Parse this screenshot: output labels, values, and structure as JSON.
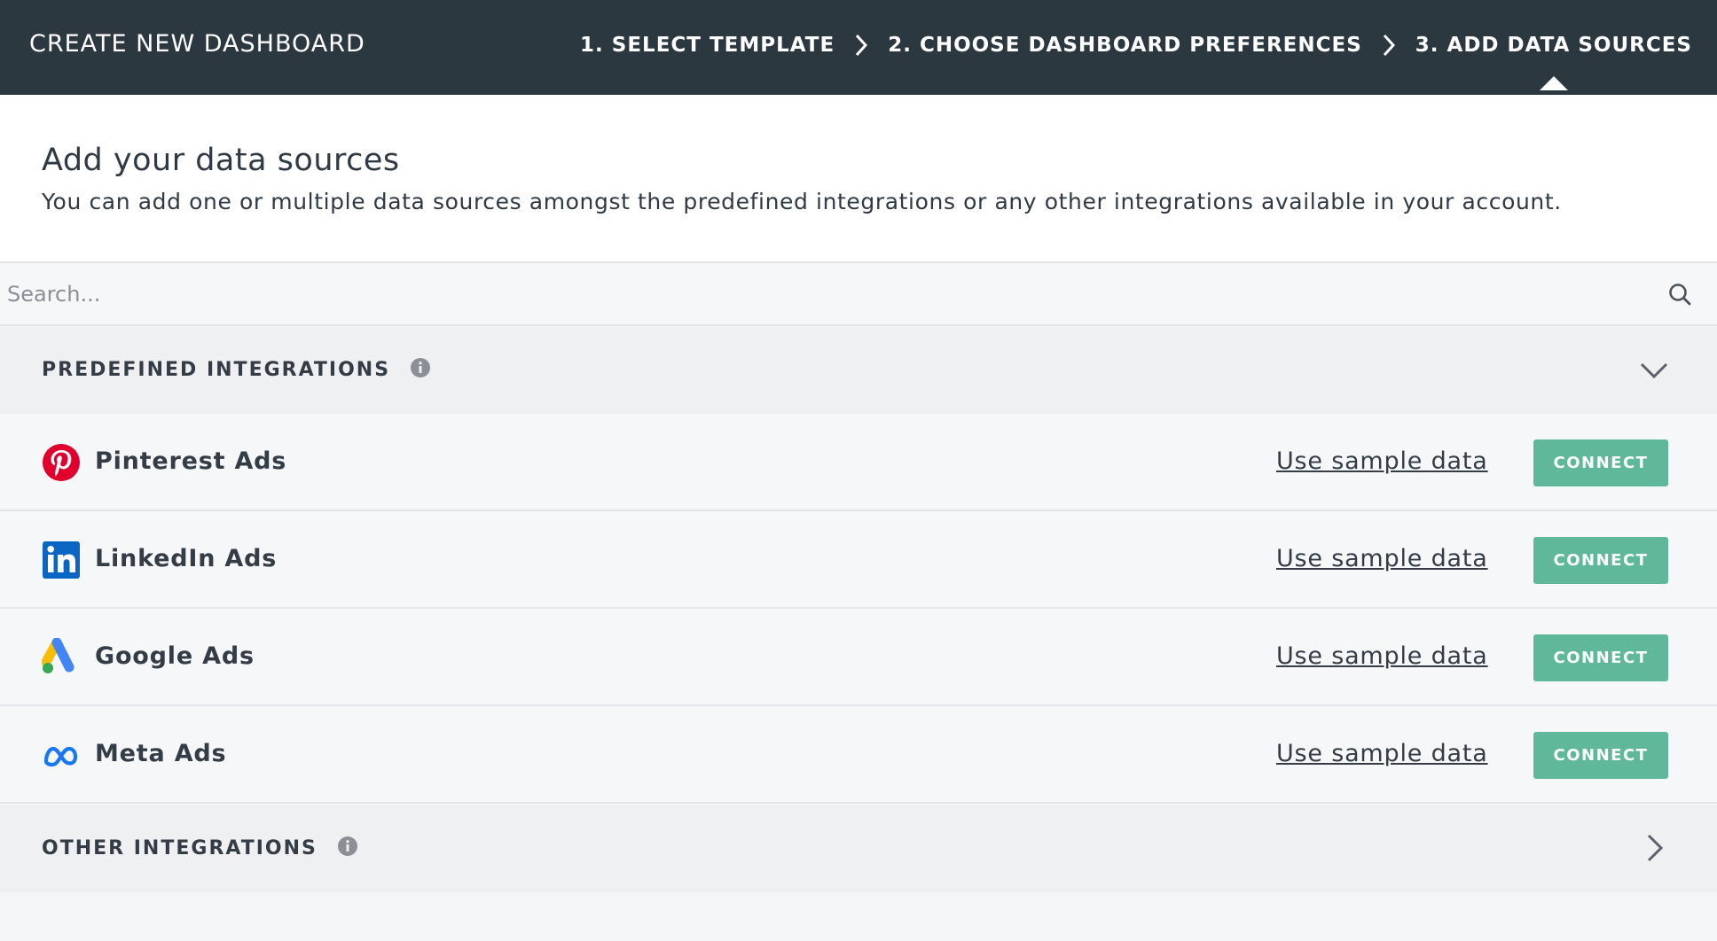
{
  "header": {
    "title": "CREATE NEW DASHBOARD",
    "steps": [
      {
        "label": "1. SELECT TEMPLATE"
      },
      {
        "label": "2. CHOOSE DASHBOARD PREFERENCES"
      },
      {
        "label": "3. ADD DATA SOURCES",
        "active": true
      }
    ]
  },
  "intro": {
    "heading": "Add your data sources",
    "description": "You can add one or multiple data sources amongst the predefined integrations or any other integrations available in your account."
  },
  "search": {
    "placeholder": "Search...",
    "value": "",
    "icon": "search-icon"
  },
  "predefined": {
    "label": "PREDEFINED INTEGRATIONS",
    "expanded": true,
    "items": [
      {
        "name": "Pinterest Ads",
        "icon": "pinterest-logo-icon",
        "sample_label": "Use sample data",
        "connect_label": "CONNECT"
      },
      {
        "name": "LinkedIn Ads",
        "icon": "linkedin-logo-icon",
        "sample_label": "Use sample data",
        "connect_label": "CONNECT"
      },
      {
        "name": "Google Ads",
        "icon": "google-ads-logo-icon",
        "sample_label": "Use sample data",
        "connect_label": "CONNECT"
      },
      {
        "name": "Meta Ads",
        "icon": "meta-logo-icon",
        "sample_label": "Use sample data",
        "connect_label": "CONNECT"
      }
    ]
  },
  "other": {
    "label": "OTHER INTEGRATIONS",
    "expanded": false
  },
  "colors": {
    "header_bg": "#2c3840",
    "connect_bg": "#5fb89a",
    "text": "#343d46"
  }
}
